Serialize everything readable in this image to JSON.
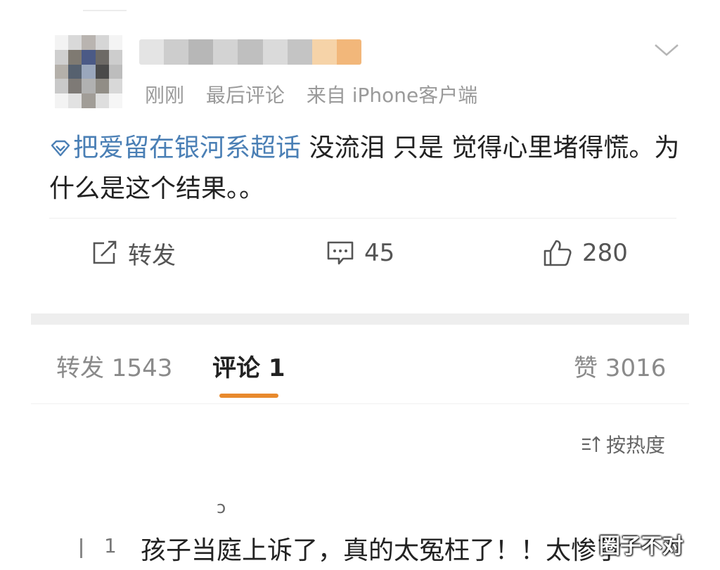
{
  "post": {
    "meta": {
      "time": "刚刚",
      "last_comment": "最后评论",
      "source": "来自 iPhone客户端"
    },
    "topic": "把爱留在银河系超话",
    "body": " 没流泪 只是 觉得心里堵得慌。为什么是这个结果。。",
    "actions": {
      "repost": "转发",
      "comments": "45",
      "likes": "280"
    }
  },
  "tabs": {
    "repost": "转发 1543",
    "comments": "评论 1",
    "likes": "赞 3016"
  },
  "sort_label": "按热度",
  "comment": {
    "mark": "ɔ",
    "count": "1",
    "text": "孩子当庭上诉了，真的太冤枉了！！太惨了"
  },
  "watermark": "圈子不对",
  "colors": {
    "accent": "#e8892c",
    "topic_link": "#4a7fb5",
    "meta_gray": "#9a9a9a"
  },
  "icons": {
    "menu": "chevron-down-icon",
    "topic": "diamond-icon",
    "repost": "share-edit-icon",
    "comments": "comment-bubble-icon",
    "likes": "thumbs-up-icon",
    "sort": "sort-icon"
  }
}
